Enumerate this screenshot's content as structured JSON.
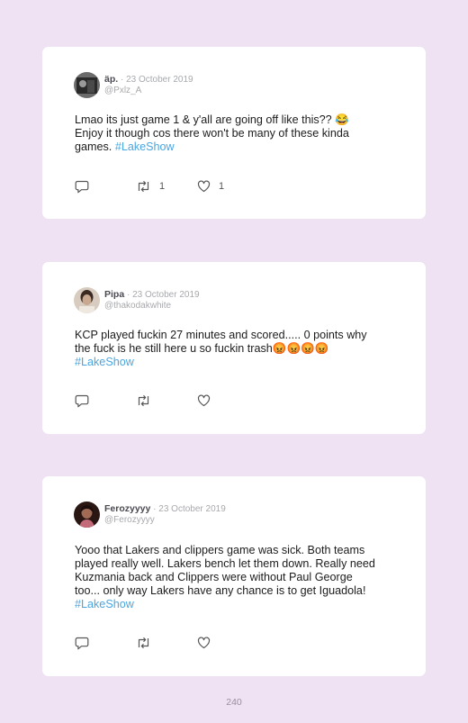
{
  "tweets": [
    {
      "name": "äp.",
      "dot": "·",
      "date": "23 October 2019",
      "handle": "@Pxlz_A",
      "text": "Lmao its just game 1 & y'all are going off like this?? 😂\nEnjoy it though cos there won't be many of these kinda\ngames. ",
      "hashtag": "#LakeShow",
      "retweets": "1",
      "likes": "1",
      "avatar_color": "#3a3a3a"
    },
    {
      "name": "Pipa",
      "dot": "·",
      "date": "23 October 2019",
      "handle": "@thakodakwhite",
      "text": "KCP played fuckin 27 minutes and scored..... 0 points why\nthe fuck is he still here u so fuckin trash😡😡😡😡\n",
      "hashtag": "#LakeShow",
      "retweets": "",
      "likes": "",
      "avatar_color": "#b7a89a"
    },
    {
      "name": "Ferozyyyy",
      "dot": "·",
      "date": "23 October 2019",
      "handle": "@Ferozyyyy",
      "text": "Yooo that Lakers and clippers game was sick. Both teams\nplayed really well. Lakers bench let them down. Really need\nKuzmania back and Clippers were without Paul George\ntoo... only way Lakers have any chance is to get Iguadola!\n",
      "hashtag": "#LakeShow",
      "retweets": "",
      "likes": "",
      "avatar_color": "#4a2a26"
    }
  ],
  "colors": {
    "background": "#efe3f3",
    "card": "#ffffff",
    "hashtag": "#4aa6e0",
    "muted": "#a7a9ad"
  },
  "icons": [
    "reply-icon",
    "retweet-icon",
    "like-icon"
  ],
  "page_number": "240"
}
